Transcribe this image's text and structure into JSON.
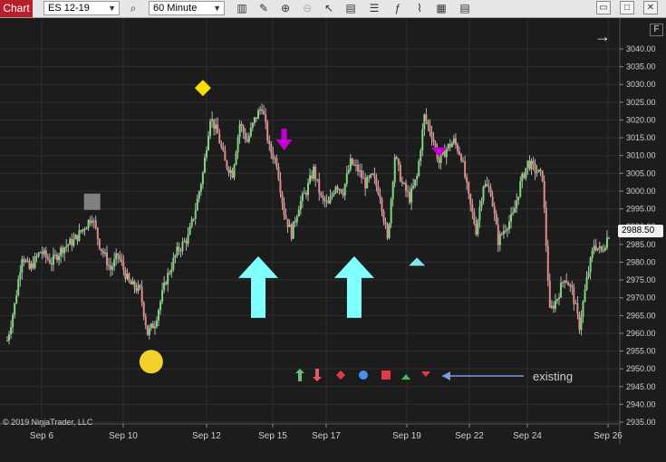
{
  "toolbar": {
    "tab_label": "Chart",
    "instrument": "ES 12-19",
    "interval": "60 Minute",
    "icons": [
      "search-icon",
      "bar-type-icon",
      "draw-pencil-icon",
      "zoom-in-icon",
      "zoom-out-icon",
      "pointer-icon",
      "data-box-icon",
      "properties-icon",
      "indicators-icon",
      "strategy-icon",
      "templates-icon"
    ],
    "window_buttons": [
      "restore-icon",
      "maximize-icon",
      "close-icon"
    ]
  },
  "chart": {
    "f_label": "F",
    "copyright": "© 2019 NinjaTrader, LLC",
    "existing_label": "existing",
    "last_price": "2988.50"
  },
  "chart_data": {
    "type": "candlestick",
    "instrument": "ES 12-19",
    "interval": "60 Minute",
    "y_ticks": [
      "3040.00",
      "3035.00",
      "3030.00",
      "3025.00",
      "3020.00",
      "3015.00",
      "3010.00",
      "3005.00",
      "3000.00",
      "2995.00",
      "2990.00",
      "2985.00",
      "2980.00",
      "2975.00",
      "2970.00",
      "2965.00",
      "2960.00",
      "2955.00",
      "2950.00",
      "2945.00",
      "2940.00",
      "2935.00"
    ],
    "x_ticks": [
      "Sep 6",
      "Sep 10",
      "Sep 12",
      "Sep 15",
      "Sep 17",
      "Sep 19",
      "Sep 22",
      "Sep 24",
      "Sep 26"
    ],
    "ylim": [
      2932,
      3044
    ],
    "price_path": [
      {
        "t": 0,
        "p": 2958
      },
      {
        "t": 2,
        "p": 2968
      },
      {
        "t": 4,
        "p": 2982
      },
      {
        "t": 6,
        "p": 2978
      },
      {
        "t": 9,
        "p": 2983
      },
      {
        "t": 12,
        "p": 2980
      },
      {
        "t": 15,
        "p": 2984
      },
      {
        "t": 18,
        "p": 2986
      },
      {
        "t": 21,
        "p": 2990
      },
      {
        "t": 23,
        "p": 2993
      },
      {
        "t": 25,
        "p": 2985
      },
      {
        "t": 28,
        "p": 2978
      },
      {
        "t": 30,
        "p": 2982
      },
      {
        "t": 33,
        "p": 2974
      },
      {
        "t": 36,
        "p": 2972
      },
      {
        "t": 38,
        "p": 2960
      },
      {
        "t": 40,
        "p": 2963
      },
      {
        "t": 43,
        "p": 2975
      },
      {
        "t": 46,
        "p": 2983
      },
      {
        "t": 49,
        "p": 2987
      },
      {
        "t": 51,
        "p": 2995
      },
      {
        "t": 53,
        "p": 3005
      },
      {
        "t": 55,
        "p": 3021
      },
      {
        "t": 57,
        "p": 3016
      },
      {
        "t": 59,
        "p": 3008
      },
      {
        "t": 61,
        "p": 3005
      },
      {
        "t": 63,
        "p": 3019
      },
      {
        "t": 65,
        "p": 3014
      },
      {
        "t": 67,
        "p": 3020
      },
      {
        "t": 69,
        "p": 3024
      },
      {
        "t": 71,
        "p": 3012
      },
      {
        "t": 73,
        "p": 3008
      },
      {
        "t": 75,
        "p": 2994
      },
      {
        "t": 77,
        "p": 2988
      },
      {
        "t": 79,
        "p": 2996
      },
      {
        "t": 81,
        "p": 3000
      },
      {
        "t": 83,
        "p": 3006
      },
      {
        "t": 85,
        "p": 2998
      },
      {
        "t": 87,
        "p": 2996
      },
      {
        "t": 89,
        "p": 3002
      },
      {
        "t": 91,
        "p": 3000
      },
      {
        "t": 93,
        "p": 3008
      },
      {
        "t": 95,
        "p": 3006
      },
      {
        "t": 97,
        "p": 3002
      },
      {
        "t": 99,
        "p": 3004
      },
      {
        "t": 101,
        "p": 2999
      },
      {
        "t": 103,
        "p": 2986
      },
      {
        "t": 105,
        "p": 3010
      },
      {
        "t": 107,
        "p": 3002
      },
      {
        "t": 109,
        "p": 2998
      },
      {
        "t": 111,
        "p": 3004
      },
      {
        "t": 113,
        "p": 3021
      },
      {
        "t": 115,
        "p": 3016
      },
      {
        "t": 117,
        "p": 3008
      },
      {
        "t": 119,
        "p": 3012
      },
      {
        "t": 121,
        "p": 3014
      },
      {
        "t": 123,
        "p": 3010
      },
      {
        "t": 125,
        "p": 2998
      },
      {
        "t": 127,
        "p": 2989
      },
      {
        "t": 129,
        "p": 3002
      },
      {
        "t": 131,
        "p": 3000
      },
      {
        "t": 133,
        "p": 2986
      },
      {
        "t": 135,
        "p": 2990
      },
      {
        "t": 137,
        "p": 2993
      },
      {
        "t": 139,
        "p": 3002
      },
      {
        "t": 141,
        "p": 3008
      },
      {
        "t": 143,
        "p": 3006
      },
      {
        "t": 145,
        "p": 3004
      },
      {
        "t": 147,
        "p": 2966
      },
      {
        "t": 149,
        "p": 2970
      },
      {
        "t": 151,
        "p": 2976
      },
      {
        "t": 153,
        "p": 2972
      },
      {
        "t": 155,
        "p": 2962
      },
      {
        "t": 157,
        "p": 2975
      },
      {
        "t": 159,
        "p": 2985
      },
      {
        "t": 161,
        "p": 2983
      },
      {
        "t": 163,
        "p": 2988
      }
    ],
    "markers": [
      {
        "name": "square-marker",
        "shape": "square",
        "t": 23,
        "price": 2997,
        "color": "#808080"
      },
      {
        "name": "circle-marker",
        "shape": "circle",
        "t": 39,
        "price": 2952,
        "color": "#f2d22a"
      },
      {
        "name": "diamond-marker",
        "shape": "diamond",
        "t": 53,
        "price": 3029,
        "color": "#f4e100"
      },
      {
        "name": "arrow-down-marker",
        "shape": "arrow-down",
        "t": 75,
        "price": 3014,
        "color": "#c000d0"
      },
      {
        "name": "arrow-up-marker-1",
        "shape": "arrow-up-big",
        "t": 68,
        "price": 2973,
        "color": "#80ffff"
      },
      {
        "name": "arrow-up-marker-2",
        "shape": "arrow-up-big",
        "t": 94,
        "price": 2973,
        "color": "#80ffff"
      },
      {
        "name": "triangle-up-marker",
        "shape": "triangle-up",
        "t": 111,
        "price": 2980,
        "color": "#7ee7ee"
      },
      {
        "name": "triangle-down-marker",
        "shape": "triangle-down",
        "t": 117,
        "price": 3011,
        "color": "#c000d0"
      }
    ],
    "legend_samples": [
      {
        "name": "legend-arrow-up-icon",
        "shape": "arrow-up",
        "color": "#6bbf7a"
      },
      {
        "name": "legend-arrow-down-icon",
        "shape": "arrow-down",
        "color": "#e05a6a"
      },
      {
        "name": "legend-diamond-icon",
        "shape": "diamond",
        "color": "#e03a48"
      },
      {
        "name": "legend-dot-icon",
        "shape": "dot",
        "color": "#4f8fe8"
      },
      {
        "name": "legend-square-icon",
        "shape": "square",
        "color": "#e03a48"
      },
      {
        "name": "legend-triangle-up-icon",
        "shape": "triangle-up",
        "color": "#3cbf5a"
      },
      {
        "name": "legend-triangle-down-icon",
        "shape": "triangle-down",
        "color": "#e03a48"
      }
    ],
    "colors": {
      "up": "#7dd87d",
      "down": "#e08a8a",
      "wick": "#d8d8d8",
      "grid": "#2e2e2e",
      "background": "#1c1c1c"
    }
  }
}
